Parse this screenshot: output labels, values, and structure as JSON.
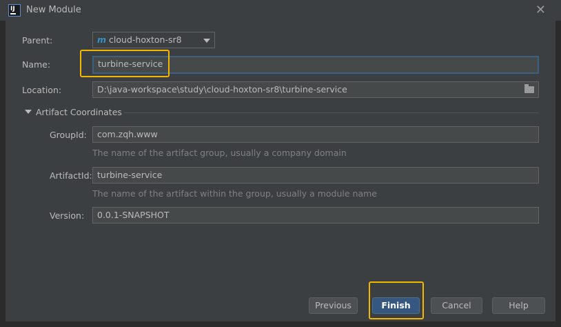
{
  "window": {
    "title": "New Module"
  },
  "form": {
    "parent_label": "Parent:",
    "parent_value": "cloud-hoxton-sr8",
    "parent_icon_glyph": "m",
    "name_label": "Name:",
    "name_value": "turbine-service",
    "location_label": "Location:",
    "location_value": "D:\\java-workspace\\study\\cloud-hoxton-sr8\\turbine-service",
    "section_title": "Artifact Coordinates",
    "groupid_label": "GroupId:",
    "groupid_value": "com.zqh.www",
    "groupid_hint": "The name of the artifact group, usually a company domain",
    "artifactid_label": "ArtifactId:",
    "artifactid_value": "turbine-service",
    "artifactid_hint": "The name of the artifact within the group, usually a module name",
    "version_label": "Version:",
    "version_value": "0.0.1-SNAPSHOT"
  },
  "buttons": {
    "previous": "Previous",
    "finish": "Finish",
    "cancel": "Cancel",
    "help": "Help"
  },
  "colors": {
    "background": "#3c3f41",
    "field_bg": "#45494a",
    "focus_border": "#3d6185",
    "primary_button": "#365880",
    "highlight": "#f5b800"
  }
}
